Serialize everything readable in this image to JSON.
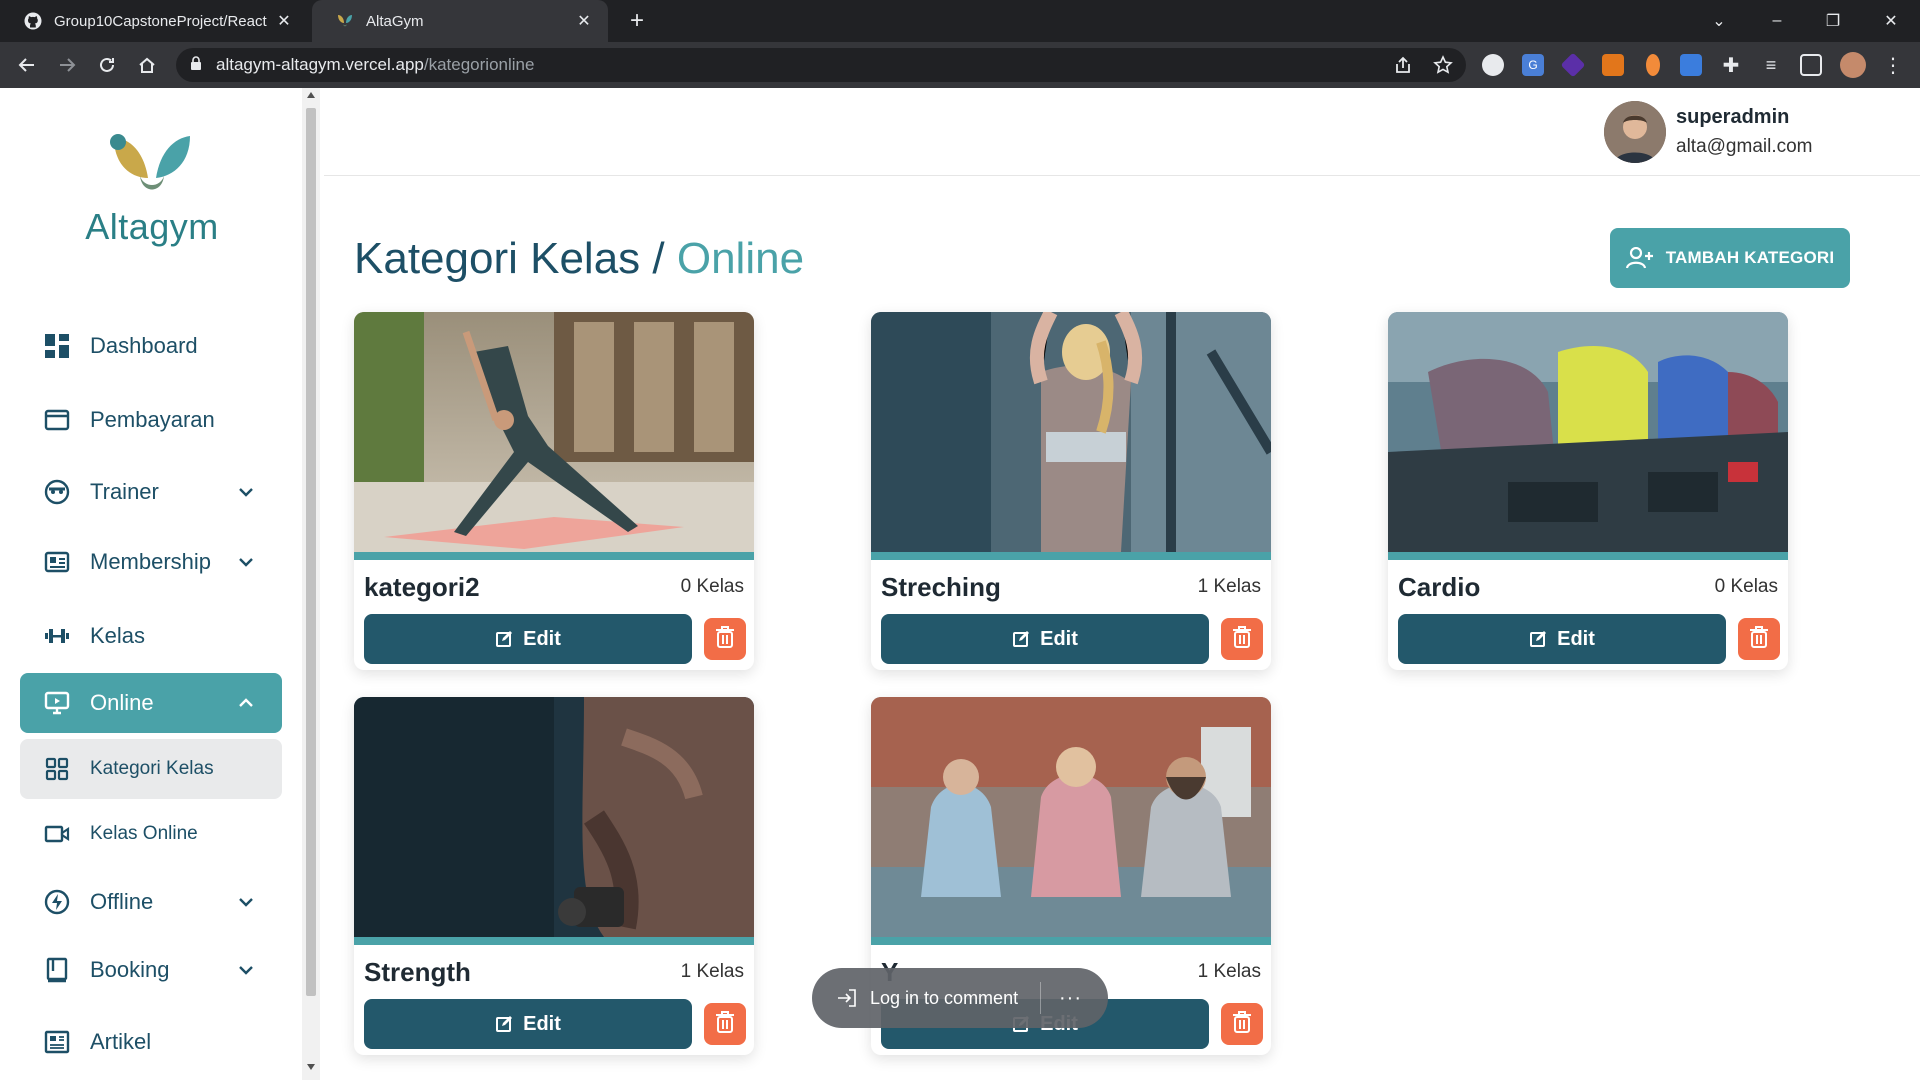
{
  "browser": {
    "tabs": [
      {
        "title": "Group10CapstoneProject/React",
        "icon": "github-icon"
      },
      {
        "title": "AltaGym",
        "icon": "altagym-favicon"
      }
    ],
    "url_host": "altagym-altagym.vercel.app",
    "url_path": "/kategorionline"
  },
  "brand": {
    "name": "Altagym",
    "accent": "#4aa2a8",
    "primary": "#1d4f66",
    "danger": "#f26d47"
  },
  "sidebar": {
    "items": [
      {
        "label": "Dashboard",
        "icon": "dashboard-icon"
      },
      {
        "label": "Pembayaran",
        "icon": "wallet-icon"
      },
      {
        "label": "Trainer",
        "icon": "trainer-icon"
      },
      {
        "label": "Membership",
        "icon": "id-card-icon"
      },
      {
        "label": "Kelas",
        "icon": "dumbbell-icon"
      },
      {
        "label": "Online",
        "icon": "monitor-icon"
      },
      {
        "label": "Kategori Kelas",
        "icon": "grid-icon"
      },
      {
        "label": "Kelas Online",
        "icon": "video-icon"
      },
      {
        "label": "Offline",
        "icon": "bolt-icon"
      },
      {
        "label": "Booking",
        "icon": "book-icon"
      },
      {
        "label": "Artikel",
        "icon": "article-icon"
      }
    ]
  },
  "header": {
    "user_name": "superadmin",
    "user_email": "alta@gmail.com"
  },
  "page": {
    "title_main": "Kategori Kelas",
    "title_sep": " / ",
    "title_accent": "Online",
    "add_button": "TAMBAH KATEGORI",
    "edit_label": "Edit"
  },
  "cards": [
    {
      "name": "kategori2",
      "count": "0 Kelas"
    },
    {
      "name": "Streching",
      "count": "1 Kelas"
    },
    {
      "name": "Cardio",
      "count": "0 Kelas"
    },
    {
      "name": "Strength",
      "count": "1 Kelas"
    },
    {
      "name": "Y",
      "count": "1 Kelas"
    }
  ],
  "toast": {
    "label": "Log in to comment",
    "more": "···"
  }
}
